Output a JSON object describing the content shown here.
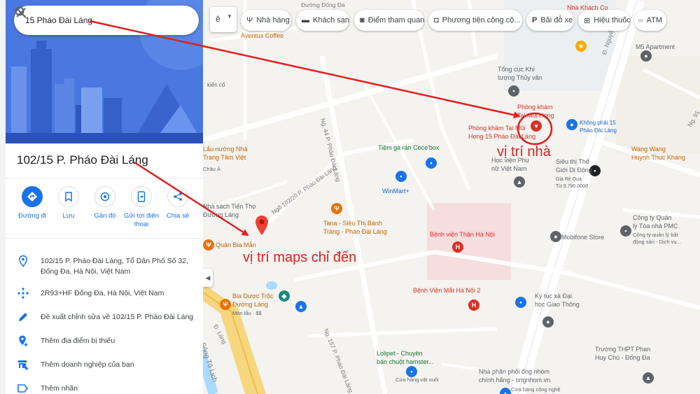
{
  "search": {
    "value": "15 Pháo Đài Láng"
  },
  "place": {
    "title": "102/15 P. Pháo Đài Láng"
  },
  "actions": [
    {
      "label": "Đường đi",
      "icon": "directions-icon"
    },
    {
      "label": "Lưu",
      "icon": "bookmark-icon"
    },
    {
      "label": "Gần đó",
      "icon": "nearby-icon"
    },
    {
      "label": "Gửi tới điện thoại",
      "icon": "send-to-phone-icon"
    },
    {
      "label": "Chia sẻ",
      "icon": "share-icon"
    }
  ],
  "info": [
    {
      "text": "102/15 P. Pháo Đài Láng, Tổ Dân Phố Số 32, Đống Đa, Hà Nội, Việt Nam",
      "icon": "location-pin-icon"
    },
    {
      "text": "2R93+HF Đống Đa, Hà Nội, Việt Nam",
      "icon": "plus-code-icon"
    },
    {
      "text": "Đề xuất chỉnh sửa về 102/15 P. Pháo Đài Láng",
      "icon": "edit-pencil-icon"
    },
    {
      "text": "Thêm địa điểm bị thiếu",
      "icon": "add-place-icon"
    },
    {
      "text": "Thêm doanh nghiệp của bạn",
      "icon": "add-business-icon"
    },
    {
      "text": "Thêm nhãn",
      "icon": "label-icon"
    }
  ],
  "chips": [
    {
      "label": "Nhà hàng",
      "icon": "restaurant-icon"
    },
    {
      "label": "Khách sạn",
      "icon": "hotel-icon"
    },
    {
      "label": "Điểm tham quan",
      "icon": "camera-icon"
    },
    {
      "label": "Phương tiện công cộ...",
      "icon": "transit-icon"
    },
    {
      "label": "Bãi đỗ xe",
      "icon": "parking-icon"
    },
    {
      "label": "Hiệu thuốc",
      "icon": "pharmacy-icon"
    },
    {
      "label": "ATM",
      "icon": "atm-icon"
    }
  ],
  "map_labels": {
    "aventus": "Aventus Coffee",
    "tong_cuc_1": "Tổng cục Khí",
    "tong_cuc_2": "tượng Thủy văn",
    "phong_kham_1": "Phòng khám",
    "phong_kham_2": "Tai Mũi Họng",
    "phong_kham_3": "Phòng khám Tai Mũi",
    "phong_kham_4": "Họng 15 Pháo Đài Láng",
    "khong_phai_1": "Không phải 15",
    "khong_phai_2": "Pháo Đài Láng",
    "nha_khach": "Nhà Khách Co",
    "m5": "M5 Apartment",
    "sieu_thi_1": "Siêu thị Thế",
    "sieu_thi_2": "Giới Di Động",
    "sieu_thi_3": "Giá Rẻ Quá",
    "sieu_thi_4": "Từ 9.790.000đ",
    "wang_1": "Wang Wang",
    "wang_2": "Huynh Thuc Khang",
    "lau_1": "Lẩu nướng Nhà",
    "lau_2": "Trang Tâm Việt",
    "tiem_ga": "Tiệm gà rán Cece'box",
    "hoc_vien_1": "Học viện Phụ",
    "hoc_vien_2": "nữ Việt Nam",
    "winmart": "WinMart+",
    "nha_sach_1": "Nhà sách Tiến Thọ",
    "nha_sach_2": "Đường Láng",
    "tana_1": "Tana - Siêu Thị Bánh",
    "tana_2": "Tráng - Pháo Đài Láng",
    "bv_than": "Bệnh viện Thận Hà Nội",
    "mobifone": "Mobifone Store",
    "cong_ty_1": "Công ty Quản",
    "cong_ty_2": "lý Tòa nhà PMC",
    "cong_ty_3": "Công ty quản lý bất",
    "cong_ty_4": "động sản - Dịch vụ...",
    "quan_bia": "Quán Bia Mẫn",
    "bv_mat": "Bệnh Viện Mắt Hà Nội 2",
    "ktx_1": "Ký túc xá Đại",
    "ktx_2": "học Giao Thông",
    "bia_duoc_1": "Bia Dược Trộc",
    "bia_duoc_2": "Đường Láng",
    "bia_duoc_3": "Món lẩu · $$",
    "lolipet_1": "Lolipet - Chuyên",
    "lolipet_2": "bán chuột hamster...",
    "lolipet_3": "Cửa hàng vật nuôi",
    "thpt_1": "Trường THPT Phan",
    "thpt_2": "Huy Chú - Đống Đa",
    "ong_1": "Nhà phân phối ống nhòm",
    "ong_2": "chính hãng - ongnhom.vn",
    "ong_3": "Cửa hàng công nghệ",
    "kien_co": "kiến cổ",
    "chau_a": "Châu Á",
    "road_nguyen_chi": "Đ. Nguyễn Chí T",
    "road_ngo_102": "Ngõ 102/20 P. Pháo Đài Láng",
    "road_ng44": "Ng. 44 P. Pháo Đài Láng",
    "road_d_lang": "Đ. Láng",
    "road_song_to": "Sông Tô Lịch",
    "road_ng157": "Ng. 157 P. Pháo Đài Láng",
    "road_dong_da": "Đường Đống Đa",
    "road_ng91": "Ng. 91"
  },
  "annotations": {
    "home": "vị trí nhà",
    "maps": "vị trí maps chỉ đến"
  },
  "colors": {
    "accent": "#1a73e8",
    "annotation": "#e02020",
    "red_pin": "#d93025",
    "orange_poi": "#e8710a",
    "map_road_yellow": "#f7d680"
  }
}
